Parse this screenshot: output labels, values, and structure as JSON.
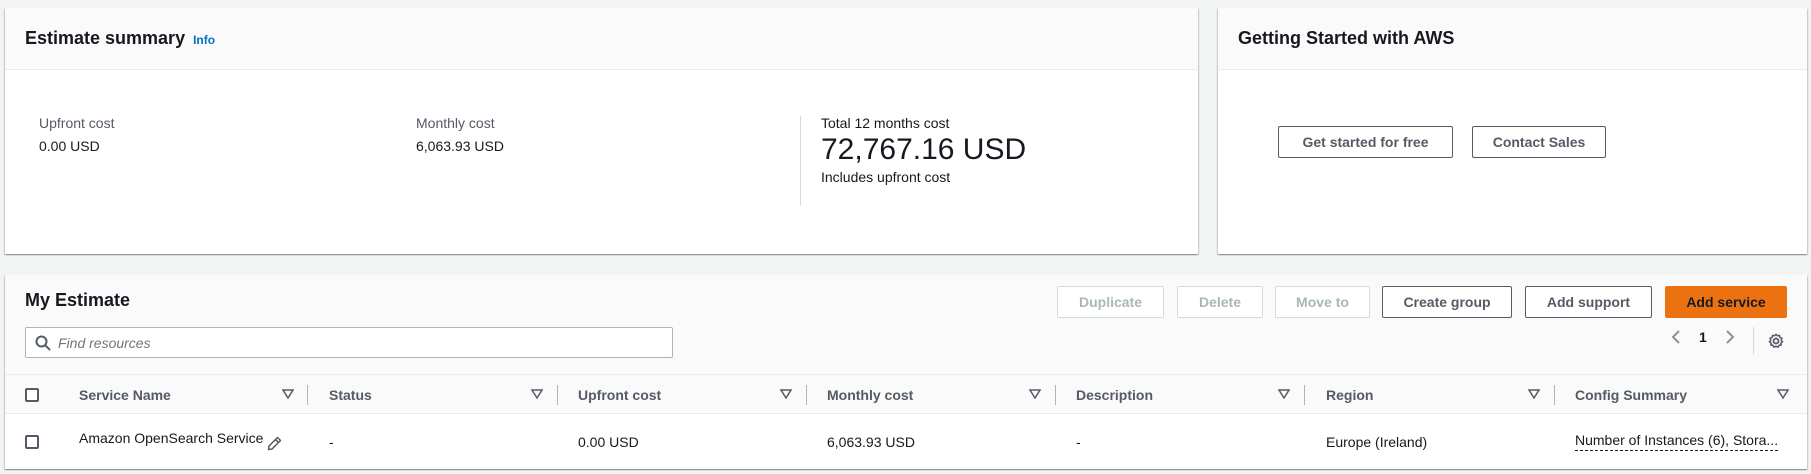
{
  "summary": {
    "title": "Estimate summary",
    "info_label": "Info",
    "upfront_label": "Upfront cost",
    "upfront_value": "0.00 USD",
    "monthly_label": "Monthly cost",
    "monthly_value": "6,063.93 USD",
    "total_label": "Total 12 months cost",
    "total_value": "72,767.16 USD",
    "total_note": "Includes upfront cost"
  },
  "getting_started": {
    "title": "Getting Started with AWS",
    "free_button": "Get started for free",
    "sales_button": "Contact Sales"
  },
  "estimate": {
    "title": "My Estimate",
    "buttons": {
      "duplicate": "Duplicate",
      "delete": "Delete",
      "move_to": "Move to",
      "create_group": "Create group",
      "add_support": "Add support",
      "add_service": "Add service"
    },
    "search_placeholder": "Find resources",
    "page_number": "1",
    "columns": [
      "Service Name",
      "Status",
      "Upfront cost",
      "Monthly cost",
      "Description",
      "Region",
      "Config Summary"
    ],
    "rows": [
      {
        "service_name": "Amazon OpenSearch Service",
        "status": "-",
        "upfront_cost": "0.00 USD",
        "monthly_cost": "6,063.93 USD",
        "description": "-",
        "region": "Europe (Ireland)",
        "config_summary": "Number of Instances (6), Stora..."
      }
    ]
  },
  "icons": {
    "search": "search-icon",
    "sort": "sort-caret-icon",
    "edit": "pencil-icon",
    "prev": "chevron-left-icon",
    "next": "chevron-right-icon",
    "settings": "gear-icon"
  },
  "colors": {
    "accent": "#ec7211",
    "link": "#0073bb",
    "background": "#f2f3f3"
  }
}
